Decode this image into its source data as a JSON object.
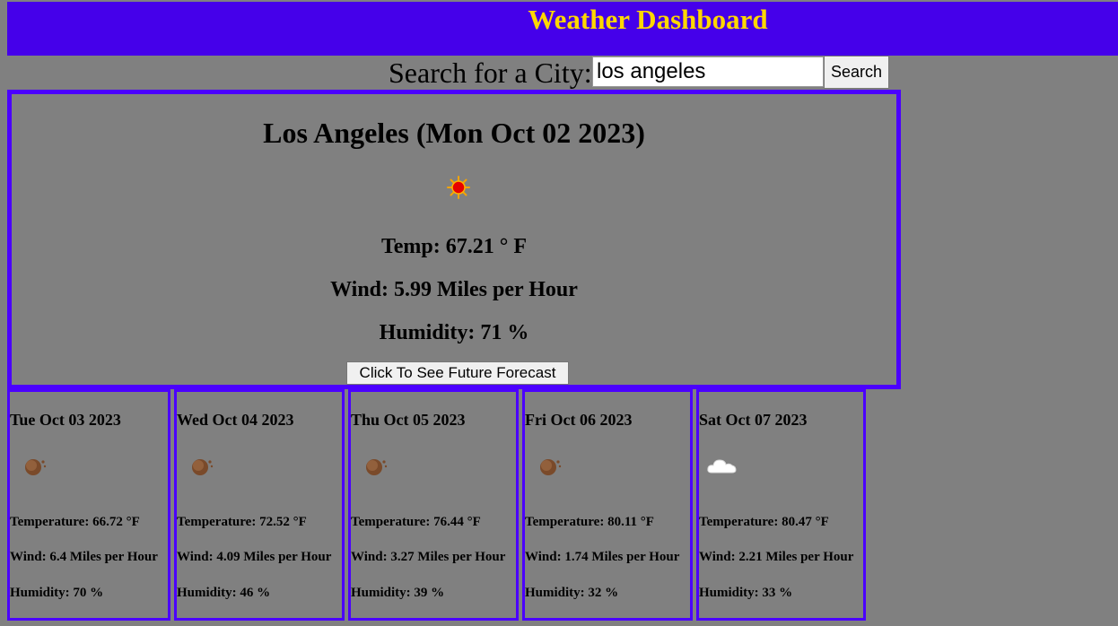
{
  "header": {
    "title": "Weather Dashboard"
  },
  "search": {
    "label": "Search for a City:",
    "value": "los angeles",
    "placeholder": "",
    "button_label": "Search"
  },
  "current": {
    "title": "Los Angeles (Mon Oct 02 2023)",
    "icon": "sun-icon",
    "temp": "Temp: 67.21 ° F",
    "wind": "Wind: 5.99 Miles per Hour",
    "humidity": "Humidity: 71 %",
    "forecast_button": "Click To See Future Forecast"
  },
  "forecast": [
    {
      "date": "Tue Oct 03 2023",
      "icon": "sun-behind-haze-icon",
      "temperature": "Temperature: 66.72 °F",
      "wind": "Wind: 6.4 Miles per Hour",
      "humidity": "Humidity: 70 %"
    },
    {
      "date": "Wed Oct 04 2023",
      "icon": "sun-behind-haze-icon",
      "temperature": "Temperature: 72.52 °F",
      "wind": "Wind: 4.09 Miles per Hour",
      "humidity": "Humidity: 46 %"
    },
    {
      "date": "Thu Oct 05 2023",
      "icon": "sun-behind-haze-icon",
      "temperature": "Temperature: 76.44 °F",
      "wind": "Wind: 3.27 Miles per Hour",
      "humidity": "Humidity: 39 %"
    },
    {
      "date": "Fri Oct 06 2023",
      "icon": "sun-behind-haze-icon",
      "temperature": "Temperature: 80.11 °F",
      "wind": "Wind: 1.74 Miles per Hour",
      "humidity": "Humidity: 32 %"
    },
    {
      "date": "Sat Oct 07 2023",
      "icon": "cloud-icon",
      "temperature": "Temperature: 80.47 °F",
      "wind": "Wind: 2.21 Miles per Hour",
      "humidity": "Humidity: 33 %"
    }
  ],
  "colors": {
    "header_bg": "#4500ea",
    "title": "#ffd700",
    "border": "#4b00ff",
    "page_bg": "#808080"
  }
}
